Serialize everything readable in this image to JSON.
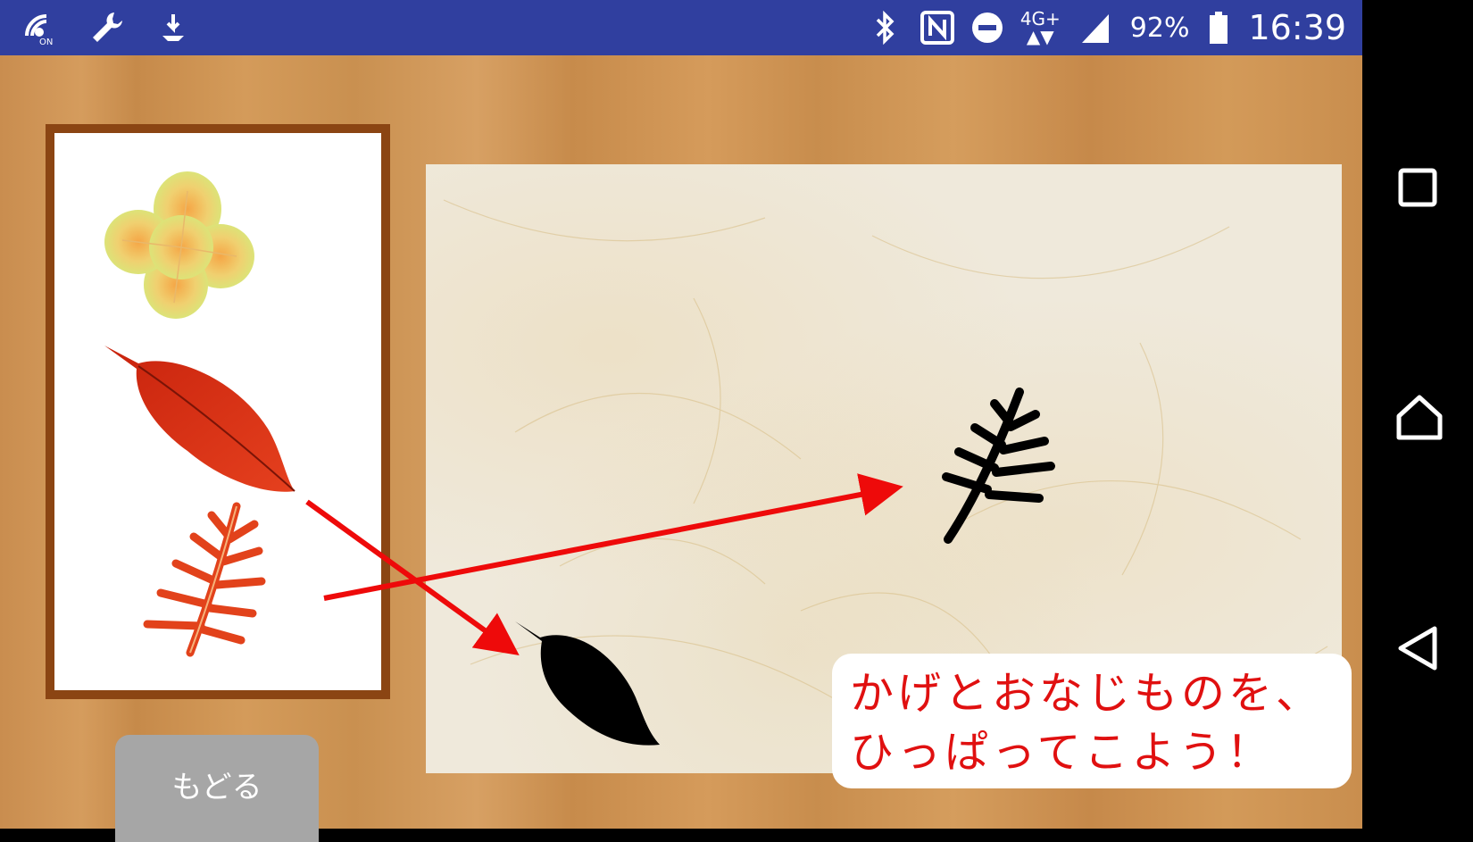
{
  "status_bar": {
    "left_icons": [
      "wifi-calling-icon",
      "wrench-icon",
      "download-icon"
    ],
    "right_icons": [
      "bluetooth-icon",
      "nfc-icon",
      "do-not-disturb-icon",
      "cell-signal-icon",
      "battery-icon"
    ],
    "network": "4G+",
    "battery": "92%",
    "time": "16:39",
    "color": "#303f9f"
  },
  "nav_bar": {
    "buttons": [
      "recents-square-icon",
      "home-icon",
      "back-triangle-icon"
    ]
  },
  "palette": {
    "items": [
      "flower-piece",
      "red-leaf-piece",
      "orange-fern-leaf-piece"
    ]
  },
  "canvas": {
    "shadows": [
      "fern-leaf-shadow",
      "oval-leaf-shadow"
    ]
  },
  "hint": {
    "line1": "かげとおなじものを、",
    "line2": "ひっぱってこよう！",
    "color": "#e01010"
  },
  "back_button": {
    "label": "もどる"
  }
}
